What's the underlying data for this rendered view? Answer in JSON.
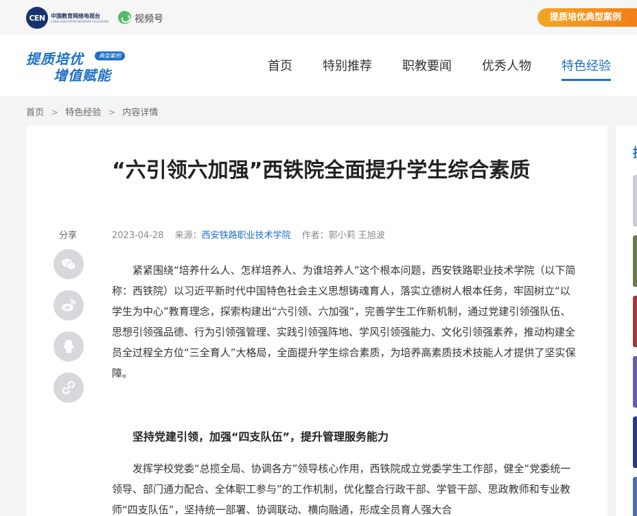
{
  "topbar": {
    "cen_logo": "CEN",
    "cen_name": "中国教育网络电视台",
    "cen_sub": "CHINA EDUCATION NETWORK TELEVISION",
    "video_label": "视频号",
    "case_button": "提质培优典型案例"
  },
  "brand": {
    "line1": "提质培优",
    "line2": "增值赋能",
    "tag": "典型案例"
  },
  "nav": {
    "items": [
      "首页",
      "特别推荐",
      "职教要闻",
      "优秀人物",
      "特色经验"
    ],
    "active_index": 4,
    "accent": "#1c6fc6"
  },
  "breadcrumb": [
    "首页",
    ">",
    "特色经验",
    ">",
    "内容详情"
  ],
  "article": {
    "title": "“六引领六加强”西铁院全面提升学生综合素质",
    "date": "2023-04-28",
    "source_label": "来源：",
    "source": "西安铁路职业技术学院",
    "author_label": "作者：",
    "authors": "郭小莉 王旭波",
    "para1": "紧紧围绕“培养什么人、怎样培养人、为谁培养人”这个根本问题，西安铁路职业技术学院（以下简称：西铁院）以习近平新时代中国特色社会主义思想铸魂育人，落实立德树人根本任务，牢固树立“以学生为中心”教育理念，探索构建出“六引领、六加强”，完善学生工作新机制，通过党建引领强队伍、思想引领强品德、行为引领强管理、实践引领强阵地、学风引领强能力、文化引领强素养，推动构建全员全过程全方位“三全育人”大格局，全面提升学生综合素质，为培养高素质技术技能人才提供了坚实保障。",
    "heading1": "坚持党建引领，加强“四支队伍”，提升管理服务能力",
    "para2": "发挥学校党委“总揽全局、协调各方”领导核心作用，西铁院成立党委学生工作部，健全“党委统一领导、部门通力配合、全体职工参与”的工作机制，优化整合行政干部、学管干部、思政教师和专业教师“四支队伍”，坚持统一部署、协调联动、横向融通，形成全员育人强大合"
  },
  "share": {
    "label": "分享",
    "buttons": [
      "wechat-icon",
      "weibo-icon",
      "qq-icon",
      "link-icon"
    ]
  },
  "side": {
    "title": "提",
    "thumb_colors": [
      "#c9ccd2",
      "#6b7a48",
      "#9e3b3b",
      "#6a5aa8",
      "#2b3c7a",
      "#4b6fa3"
    ]
  }
}
